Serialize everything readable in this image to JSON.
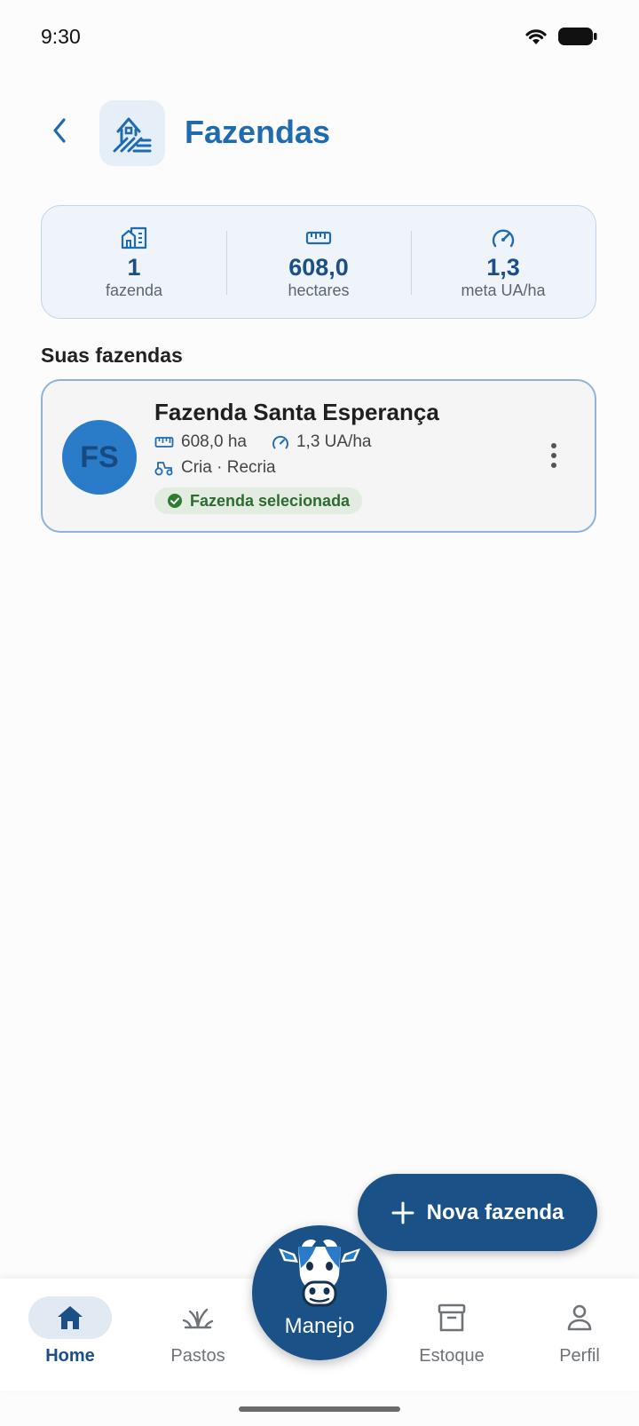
{
  "status_bar": {
    "time": "9:30"
  },
  "header": {
    "title": "Fazendas"
  },
  "summary": [
    {
      "icon": "building-icon",
      "value": "1",
      "label": "fazenda"
    },
    {
      "icon": "ruler-icon",
      "value": "608,0",
      "label": "hectares"
    },
    {
      "icon": "gauge-icon",
      "value": "1,3",
      "label": "meta UA/ha"
    }
  ],
  "section_title": "Suas fazendas",
  "farm": {
    "initials": "FS",
    "name": "Fazenda Santa Esperança",
    "area": "608,0 ha",
    "stocking": "1,3 UA/ha",
    "activities": "Cria · Recria",
    "badge": "Fazenda selecionada"
  },
  "fab": {
    "label": "Nova fazenda"
  },
  "nav": {
    "items": [
      {
        "label": "Home",
        "icon": "home-icon"
      },
      {
        "label": "Pastos",
        "icon": "grass-icon"
      },
      {
        "label": "Estoque",
        "icon": "archive-icon"
      },
      {
        "label": "Perfil",
        "icon": "person-icon"
      }
    ],
    "center_label": "Manejo"
  },
  "colors": {
    "primary": "#1f6bb0",
    "dark_primary": "#1a5288",
    "badge_green": "#2e6b31"
  }
}
